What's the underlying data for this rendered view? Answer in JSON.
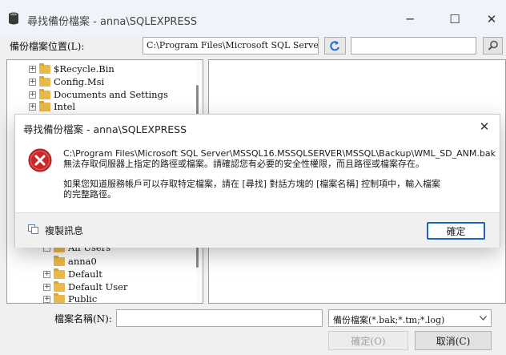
{
  "window": {
    "title": "尋找備份檔案 - anna\\SQLEXPRESS",
    "minimize": "─",
    "maximize": "☐",
    "close": "✕"
  },
  "location": {
    "label": "備份檔案位置(L):",
    "path": "C:\\Program Files\\Microsoft SQL Server\\MSSQ"
  },
  "tree": {
    "items_top": [
      {
        "label": "$Recycle.Bin"
      },
      {
        "label": "Config.Msi"
      },
      {
        "label": "Documents and Settings"
      },
      {
        "label": "Intel"
      }
    ],
    "partial_item": "All Users",
    "items_bottom": [
      {
        "label": "anna0",
        "expandable": false
      },
      {
        "label": "Default",
        "expandable": true
      },
      {
        "label": "Default User",
        "expandable": true
      },
      {
        "label": "Public",
        "expandable": true
      }
    ]
  },
  "filename": {
    "label": "檔案名稱(N):",
    "value": "",
    "filter": "備份檔案(*.bak;*.tm;*.log)"
  },
  "buttons": {
    "ok": "確定(O)",
    "cancel": "取消(C)"
  },
  "dialog": {
    "title": "尋找備份檔案 - anna\\SQLEXPRESS",
    "line1": "C:\\Program Files\\Microsoft SQL Server\\MSSQL16.MSSQLSERVER\\MSSQL\\Backup\\WML_SD_ANM.bak",
    "line2": "無法存取伺服器上指定的路徑或檔案。請確認您有必要的安全性權限，而且路徑或檔案存在。",
    "line3": "如果您知道服務帳戶可以存取特定檔案，請在 [尋找] 對話方塊的 [檔案名稱] 控制項中，輸入檔案",
    "line4": "的完整路徑。",
    "copy_label": "複製訊息",
    "ok": "確定",
    "close": "✕"
  }
}
